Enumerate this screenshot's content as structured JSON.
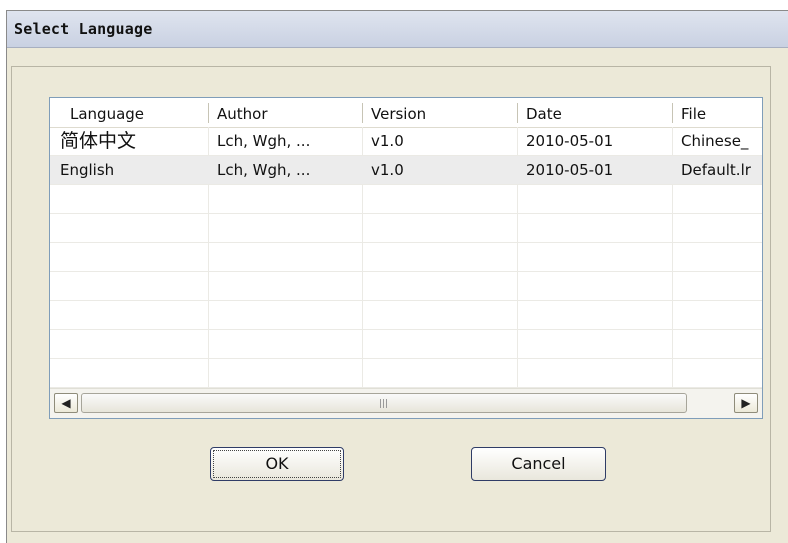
{
  "dialog": {
    "title": "Select Language"
  },
  "list": {
    "columns": [
      "Language",
      "Author",
      "Version",
      "Date",
      "File"
    ],
    "rows": [
      [
        "简体中文",
        "Lch, Wgh, ...",
        "v1.0",
        "2010-05-01",
        "Chinese_"
      ],
      [
        "English",
        "Lch, Wgh, ...",
        "v1.0",
        "2010-05-01",
        "Default.lr"
      ]
    ]
  },
  "scrollbar": {
    "left_icon": "scroll-left-arrow-icon",
    "right_icon": "scroll-right-arrow-icon",
    "left_glyph": "◀",
    "right_glyph": "▶"
  },
  "buttons": {
    "ok_label": "OK",
    "cancel_label": "Cancel"
  },
  "colors": {
    "dialog_bg": "#ece9d8",
    "selection_row": "#ececec",
    "button_border": "#2f3c66"
  }
}
